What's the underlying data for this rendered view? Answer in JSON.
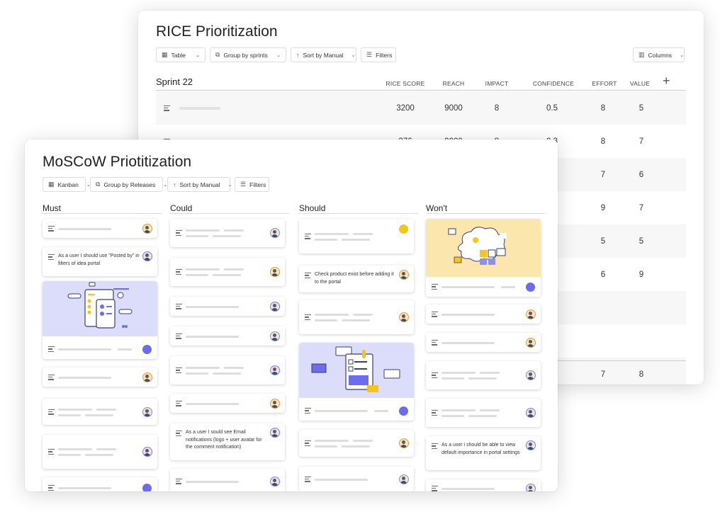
{
  "rice": {
    "title": "RICE Prioritization",
    "toolbar": {
      "view": "Table",
      "group": "Group by sprints",
      "sort": "Sort by Manual",
      "filters": "Filters",
      "columns": "Columns"
    },
    "sprint": "Sprint 22",
    "headers": [
      "RICE SCORE",
      "REACH",
      "IMPACT",
      "CONFIDENCE",
      "EFFORT",
      "VALUE"
    ],
    "rows": [
      [
        "3200",
        "9000",
        "8",
        "0.5",
        "8",
        "5"
      ],
      [
        "376",
        "9000",
        "8",
        "0.3",
        "8",
        "7"
      ],
      [
        "",
        "",
        "",
        "",
        "7",
        "6"
      ],
      [
        "",
        "",
        "",
        "",
        "9",
        "7"
      ],
      [
        "",
        "",
        "",
        "",
        "5",
        "5"
      ],
      [
        "",
        "",
        "",
        "",
        "6",
        "9"
      ],
      [
        "",
        "",
        "",
        "",
        "",
        ""
      ],
      [
        "",
        "",
        "",
        "",
        "",
        ""
      ],
      [
        "",
        "",
        "",
        "",
        "7",
        "8"
      ]
    ]
  },
  "moscow": {
    "title": "MoSCoW Priotitization",
    "toolbar": {
      "view": "Kanban",
      "group": "Group by Releases",
      "sort": "Sort by Manual",
      "filters": "Filters"
    },
    "columns": [
      {
        "name": "Must",
        "cards": [
          {
            "text": ""
          },
          {
            "text": "As a user I should use \"Posted by\" in filters of idea portal"
          },
          {
            "text": "",
            "illustration": "mobile-app-illustration"
          },
          {
            "text": ""
          },
          {
            "text": ""
          },
          {
            "text": ""
          },
          {
            "text": ""
          }
        ]
      },
      {
        "name": "Could",
        "cards": [
          {
            "text": ""
          },
          {
            "text": ""
          },
          {
            "text": ""
          },
          {
            "text": ""
          },
          {
            "text": ""
          },
          {
            "text": ""
          },
          {
            "text": "As a user I sould see Email notifications (logo + user avatar for the comment notification)"
          },
          {
            "text": ""
          }
        ]
      },
      {
        "name": "Should",
        "cards": [
          {
            "text": ""
          },
          {
            "text": "Check product exist before adding it to the portal"
          },
          {
            "text": ""
          },
          {
            "text": "",
            "illustration": "document-illustration"
          },
          {
            "text": ""
          },
          {
            "text": ""
          }
        ]
      },
      {
        "name": "Won't",
        "cards": [
          {
            "text": "",
            "illustration": "idea-cloud-illustration"
          },
          {
            "text": ""
          },
          {
            "text": ""
          },
          {
            "text": ""
          },
          {
            "text": ""
          },
          {
            "text": "As a user i should be able to view default importance in portal settings"
          },
          {
            "text": ""
          }
        ]
      }
    ]
  },
  "colors": {
    "accent": "#6c6cf0",
    "illustration_blue": "#dcdcfb",
    "illustration_yellow": "#fbe6ae",
    "avatar_yellow": "#f5c518"
  }
}
